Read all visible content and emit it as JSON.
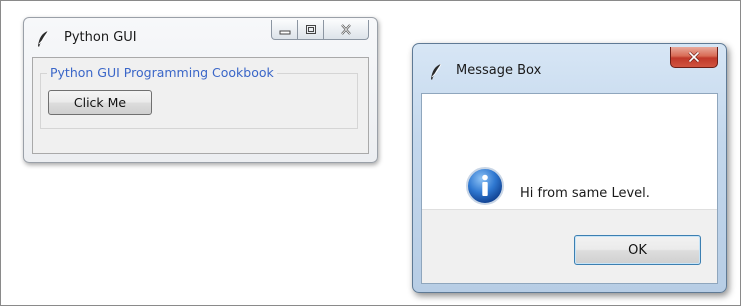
{
  "main_window": {
    "title": "Python GUI",
    "title_icon": "feather-icon",
    "controls": [
      "minimize-icon",
      "maximize-icon",
      "close-icon"
    ],
    "label_frame": {
      "text": "Python GUI Programming Cookbook",
      "color": "#3a66c8"
    },
    "button_label": "Click Me"
  },
  "message_box": {
    "title": "Message Box",
    "title_icon": "feather-icon",
    "close_icon": "close-icon",
    "icon": "info-icon",
    "message": "Hi from same Level.",
    "ok_label": "OK",
    "close_button_color": "#c0392a"
  }
}
